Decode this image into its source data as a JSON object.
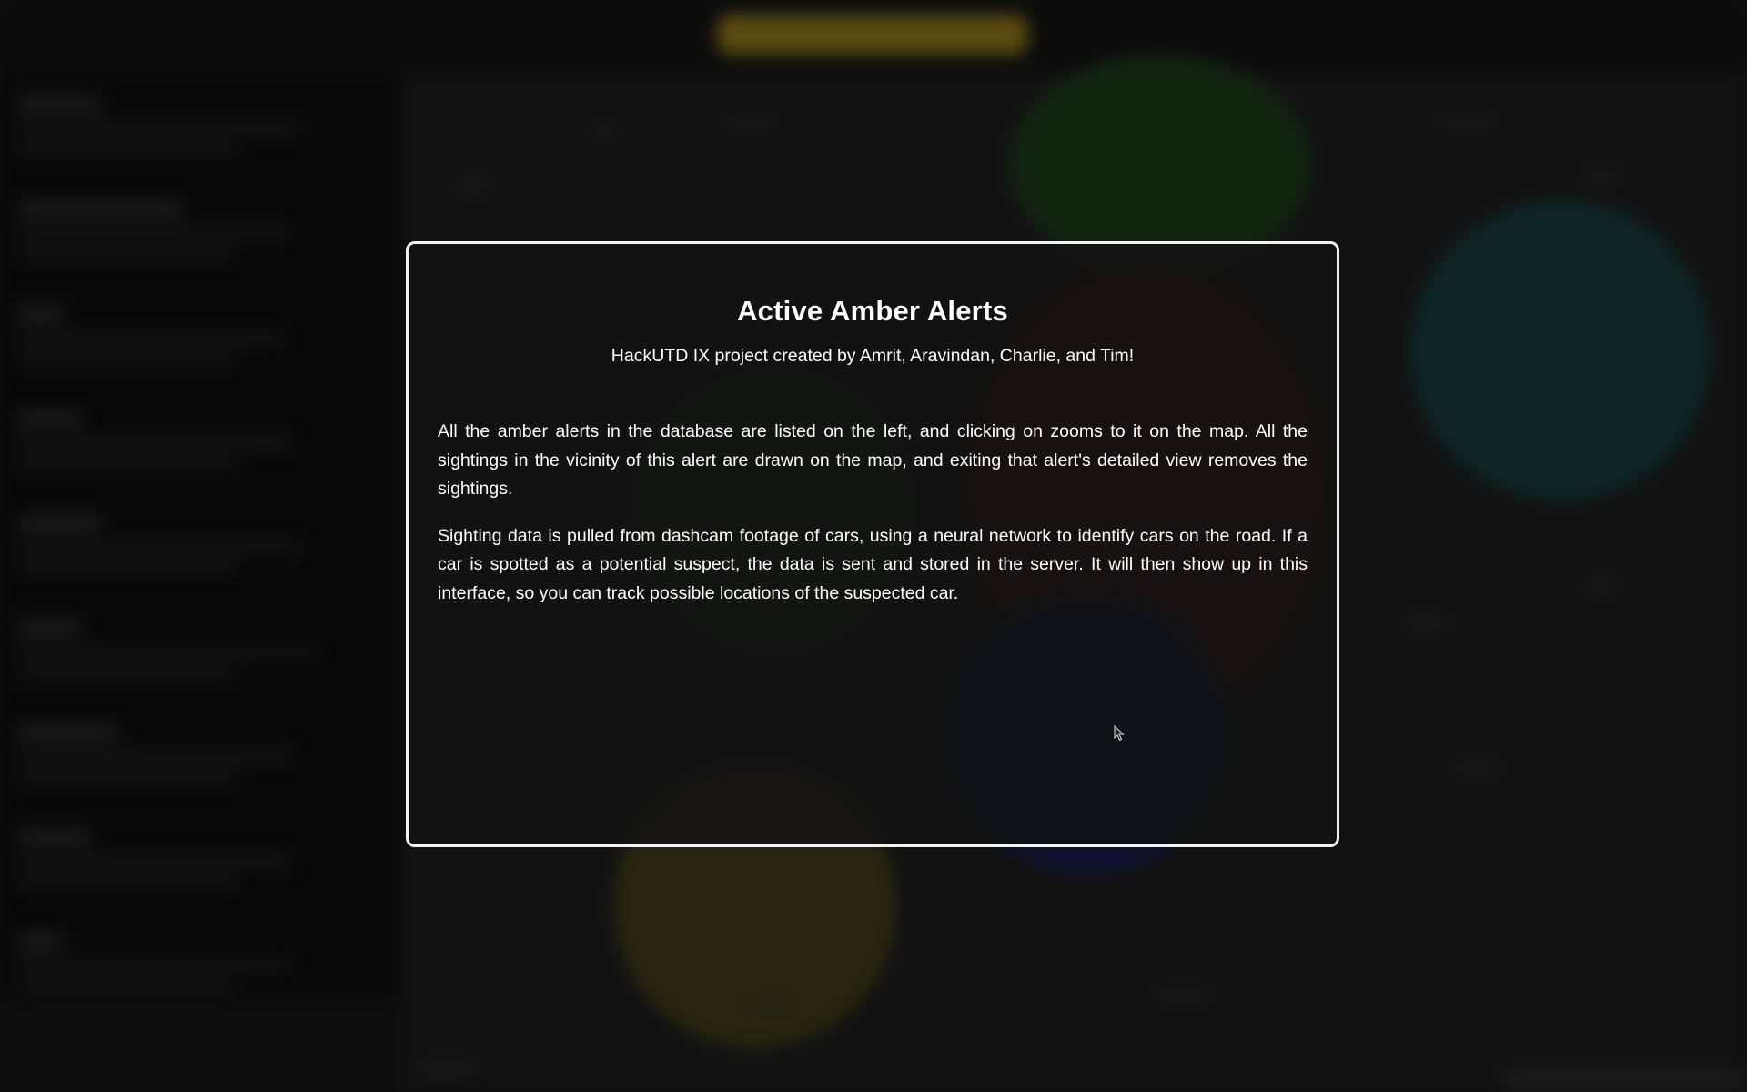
{
  "modal": {
    "title": "Active Amber Alerts",
    "subtitle": "HackUTD IX project created by Amrit, Aravindan, Charlie, and Tim!",
    "paragraphs": [
      "All the amber alerts in the database are listed on the left, and clicking on zooms to it on the map. All the sightings in the vicinity of this alert are drawn on the map, and exiting that alert's detailed view removes the sightings.",
      "Sighting data is pulled from dashcam footage of cars, using a neural network to identify cars on the road. If a car is spotted as a potential suspect, the data is sent and stored in the server. It will then show up in this interface, so you can track possible locations of the suspected car."
    ]
  },
  "colors": {
    "background": "#161616",
    "modal_border": "#f2f2f2",
    "modal_text": "#ffffff",
    "title_bar_accent": "#8a7418"
  },
  "icons": {
    "cursor": "mouse-pointer-icon"
  }
}
